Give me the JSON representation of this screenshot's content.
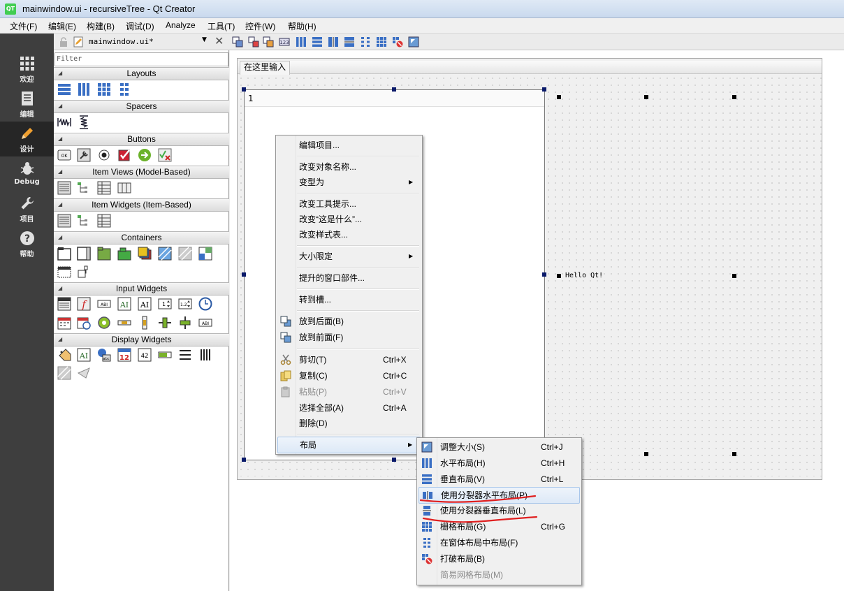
{
  "window": {
    "title": "mainwindow.ui - recursiveTree - Qt Creator"
  },
  "menubar": [
    "文件(F)",
    "编辑(E)",
    "构建(B)",
    "调试(D)",
    "Analyze",
    "工具(T)",
    "控件(W)",
    "帮助(H)"
  ],
  "modebar": [
    {
      "label": "欢迎",
      "icon": "grid-icon"
    },
    {
      "label": "编辑",
      "icon": "document-icon"
    },
    {
      "label": "设计",
      "icon": "pencil-icon"
    },
    {
      "label": "Debug",
      "icon": "bug-icon"
    },
    {
      "label": "项目",
      "icon": "wrench-icon"
    },
    {
      "label": "帮助",
      "icon": "help-icon"
    }
  ],
  "doc_toolbar": {
    "file_name": "mainwindow.ui*"
  },
  "widget_box": {
    "filter_placeholder": "Filter",
    "categories": [
      {
        "name": "Layouts"
      },
      {
        "name": "Spacers"
      },
      {
        "name": "Buttons"
      },
      {
        "name": "Item Views (Model-Based)"
      },
      {
        "name": "Item Widgets (Item-Based)"
      },
      {
        "name": "Containers"
      },
      {
        "name": "Input Widgets"
      },
      {
        "name": "Display Widgets"
      }
    ]
  },
  "form": {
    "menu_placeholder": "在这里输入",
    "tree_header": "1",
    "label_text": "Hello Qt!"
  },
  "context_menu": {
    "items": [
      {
        "label": "编辑项目..."
      },
      {
        "label": "改变对象名称..."
      },
      {
        "label": "变型为",
        "submenu": true
      },
      {
        "label": "改变工具提示..."
      },
      {
        "label": "改变“这是什么”..."
      },
      {
        "label": "改变样式表..."
      },
      {
        "label": "大小限定",
        "submenu": true
      },
      {
        "label": "提升的窗口部件..."
      },
      {
        "label": "转到槽..."
      },
      {
        "label": "放到后面(B)"
      },
      {
        "label": "放到前面(F)"
      },
      {
        "label": "剪切(T)",
        "shortcut": "Ctrl+X"
      },
      {
        "label": "复制(C)",
        "shortcut": "Ctrl+C"
      },
      {
        "label": "粘贴(P)",
        "shortcut": "Ctrl+V",
        "disabled": true
      },
      {
        "label": "选择全部(A)",
        "shortcut": "Ctrl+A"
      },
      {
        "label": "删除(D)"
      },
      {
        "label": "布局",
        "submenu": true
      }
    ]
  },
  "layout_submenu": {
    "items": [
      {
        "label": "调整大小(S)",
        "shortcut": "Ctrl+J"
      },
      {
        "label": "水平布局(H)",
        "shortcut": "Ctrl+H"
      },
      {
        "label": "垂直布局(V)",
        "shortcut": "Ctrl+L"
      },
      {
        "label": "使用分裂器水平布局(P)"
      },
      {
        "label": "使用分裂器垂直布局(L)"
      },
      {
        "label": "栅格布局(G)",
        "shortcut": "Ctrl+G"
      },
      {
        "label": "在窗体布局中布局(F)"
      },
      {
        "label": "打破布局(B)"
      },
      {
        "label": "简易网格布局(M)",
        "disabled": true
      }
    ]
  },
  "colors": {
    "modebar_bg": "#3e3e3e",
    "highlight": "#dde9f7",
    "annotation_red": "#e02020"
  }
}
